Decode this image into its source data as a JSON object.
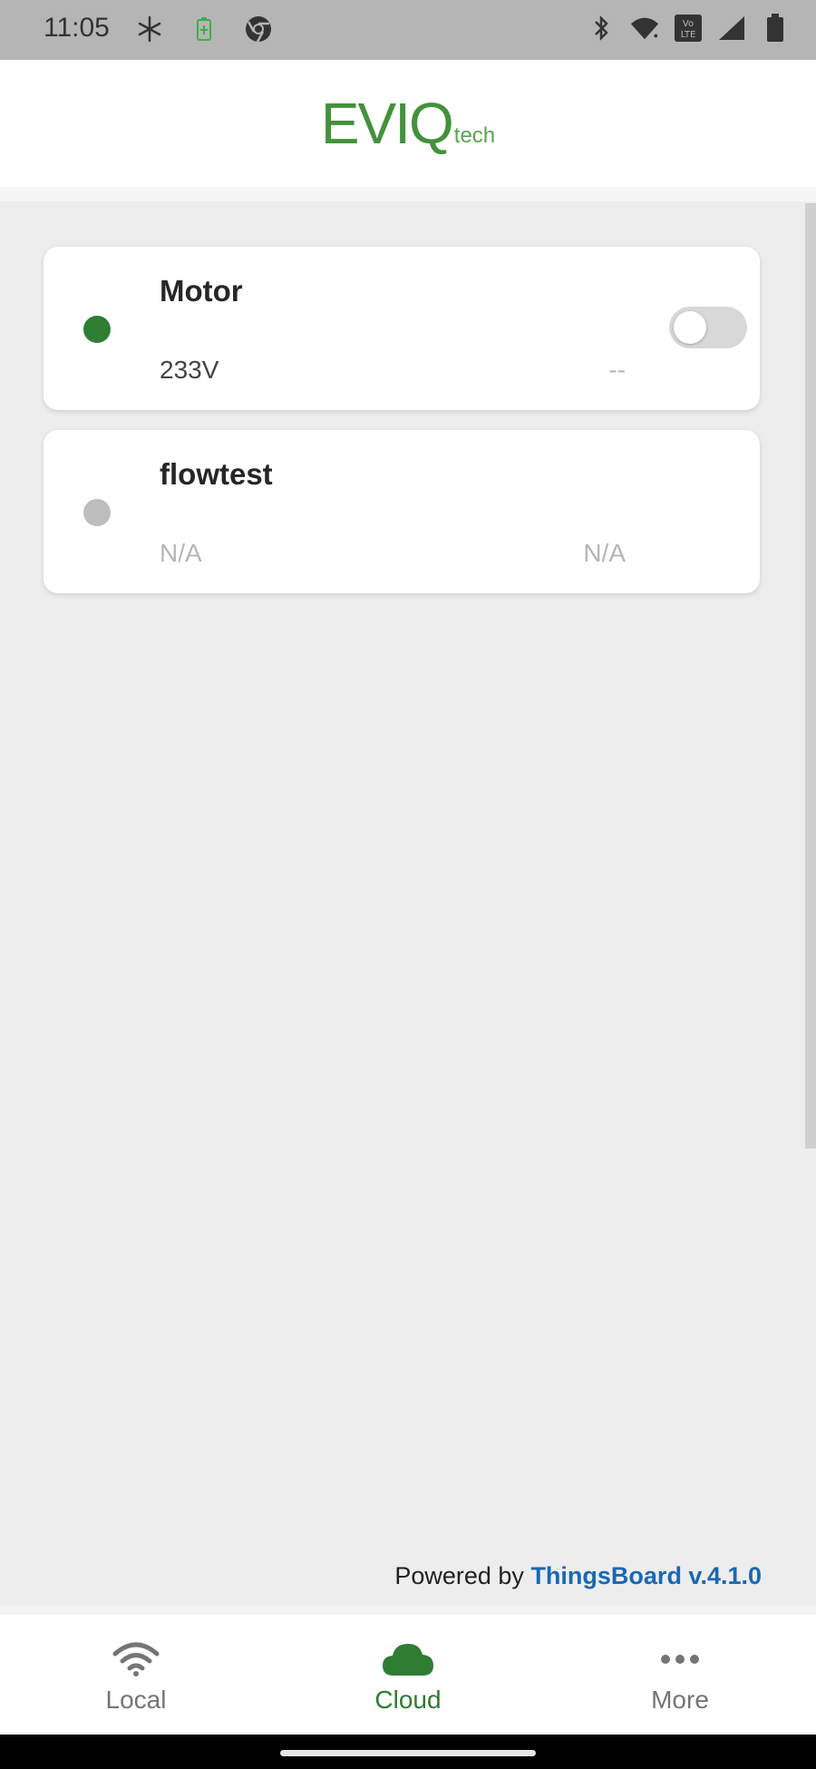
{
  "status_bar": {
    "time": "11:05",
    "left_icons": [
      "sparkle-icon",
      "battery-saver-icon",
      "chrome-icon"
    ],
    "right_icons": [
      "bluetooth-icon",
      "wifi-icon",
      "volte-icon",
      "signal-icon",
      "battery-icon"
    ]
  },
  "header": {
    "logo_main": "EVIQ",
    "logo_sub": "tech",
    "brand_color": "#43913d"
  },
  "devices": [
    {
      "name": "Motor",
      "status": "online",
      "status_color": "#2e7d32",
      "value_left": "233V",
      "value_right": "--",
      "toggle": {
        "on": false
      }
    },
    {
      "name": "flowtest",
      "status": "offline",
      "status_color": "#bdbdbd",
      "value_left": "N/A",
      "value_right": "N/A"
    }
  ],
  "footer": {
    "prefix": "Powered by",
    "brand": "ThingsBoard v.4.1.0",
    "brand_color": "#1a68b4"
  },
  "bottom_nav": {
    "items": [
      {
        "label": "Local",
        "icon": "wifi-icon",
        "active": false
      },
      {
        "label": "Cloud",
        "icon": "cloud-icon",
        "active": true
      },
      {
        "label": "More",
        "icon": "more-horizontal-icon",
        "active": false
      }
    ],
    "active_color": "#2e7d32",
    "inactive_color": "#757575"
  }
}
